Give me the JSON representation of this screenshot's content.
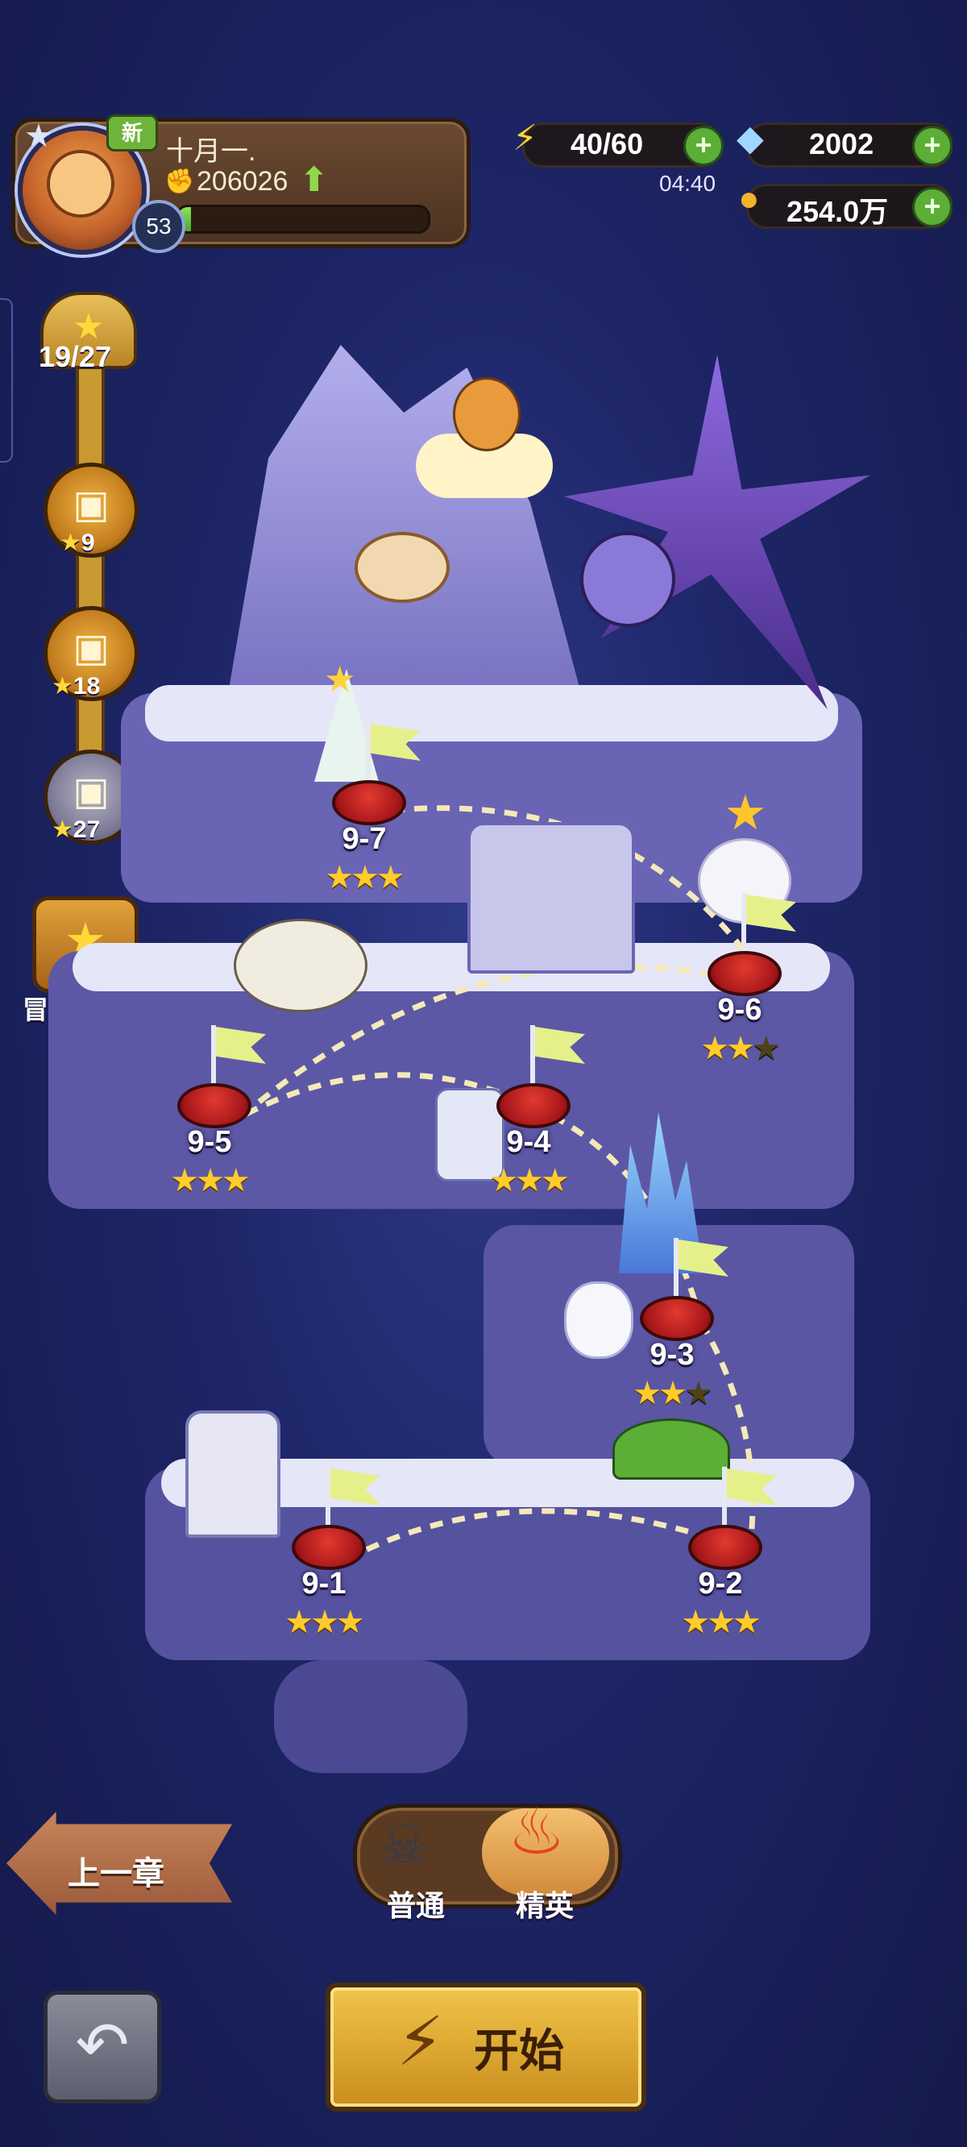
{
  "player": {
    "badge": "新",
    "name": "十月一.",
    "power": "206026",
    "level": "53",
    "xp_progress": 0.05
  },
  "resources": {
    "energy": "40/60",
    "energy_timer": "04:40",
    "gems": "2002",
    "coins": "254.0万"
  },
  "star_track": {
    "progress": "19/27",
    "chests": [
      {
        "stars": "9",
        "locked": false
      },
      {
        "stars": "18",
        "locked": false
      },
      {
        "stars": "27",
        "locked": true
      }
    ]
  },
  "archive": {
    "label": "冒险档案"
  },
  "stages": [
    {
      "id": "9-1",
      "stars": 3
    },
    {
      "id": "9-2",
      "stars": 3
    },
    {
      "id": "9-3",
      "stars": 2
    },
    {
      "id": "9-4",
      "stars": 3
    },
    {
      "id": "9-5",
      "stars": 3
    },
    {
      "id": "9-6",
      "stars": 2
    },
    {
      "id": "9-7",
      "stars": 3
    }
  ],
  "nav": {
    "prev_chapter": "上一章",
    "mode_normal": "普通",
    "mode_elite": "精英",
    "selected_mode": "精英",
    "start": "开始"
  },
  "icons": {
    "energy": "lightning-icon",
    "gems": "diamond-icon",
    "coins": "coin-icon",
    "back": "return-arrow-icon"
  }
}
